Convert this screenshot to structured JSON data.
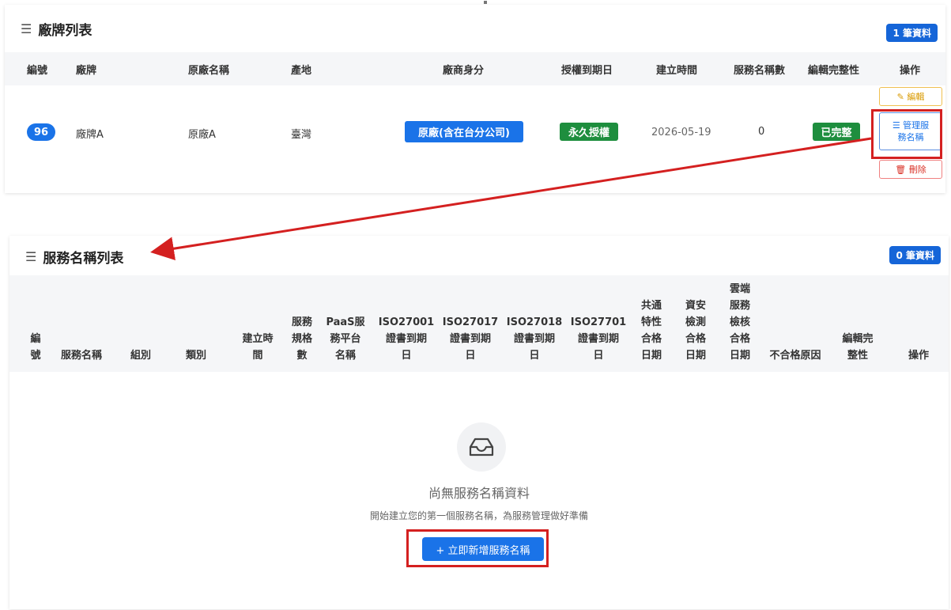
{
  "brand_panel": {
    "title": "廠牌列表",
    "count_badge": "1 筆資料",
    "columns": [
      "編號",
      "廠牌",
      "原廠名稱",
      "產地",
      "廠商身分",
      "授權到期日",
      "建立時間",
      "服務名稱數",
      "編輯完整性",
      "操作"
    ],
    "row": {
      "id": "96",
      "brand": "廠牌A",
      "original_name": "原廠A",
      "origin": "臺灣",
      "vendor_identity": "原廠(含在台分公司)",
      "license_expiry": "永久授權",
      "created_at": "2026-05-19",
      "service_count": "0",
      "completeness": "已完整",
      "actions": {
        "edit": "✎ 編輯",
        "manage": "☰ 管理服\n務名稱",
        "delete": "🗑 刪除"
      }
    }
  },
  "service_panel": {
    "title": "服務名稱列表",
    "count_badge": "0 筆資料",
    "columns": [
      "編\n號",
      "服務名稱",
      "組別",
      "類別",
      "建立時\n間",
      "服務\n規格\n數",
      "PaaS服\n務平台\n名稱",
      "ISO27001\n證書到期\n日",
      "ISO27017\n證書到期\n日",
      "ISO27018\n證書到期\n日",
      "ISO27701\n證書到期\n日",
      "共通\n特性\n合格\n日期",
      "資安\n檢測\n合格\n日期",
      "雲端\n服務\n檢核\n合格\n日期",
      "不合格原因",
      "編輯完\n整性",
      "操作"
    ],
    "empty_state": {
      "icon": "inbox-icon",
      "title": "尚無服務名稱資料",
      "subtitle": "開始建立您的第一個服務名稱，為服務管理做好準備",
      "button": "+ 立即新增服務名稱"
    }
  },
  "colors": {
    "primary": "#1a73e8",
    "success": "#1e8e3e",
    "annotation": "#d42020"
  }
}
